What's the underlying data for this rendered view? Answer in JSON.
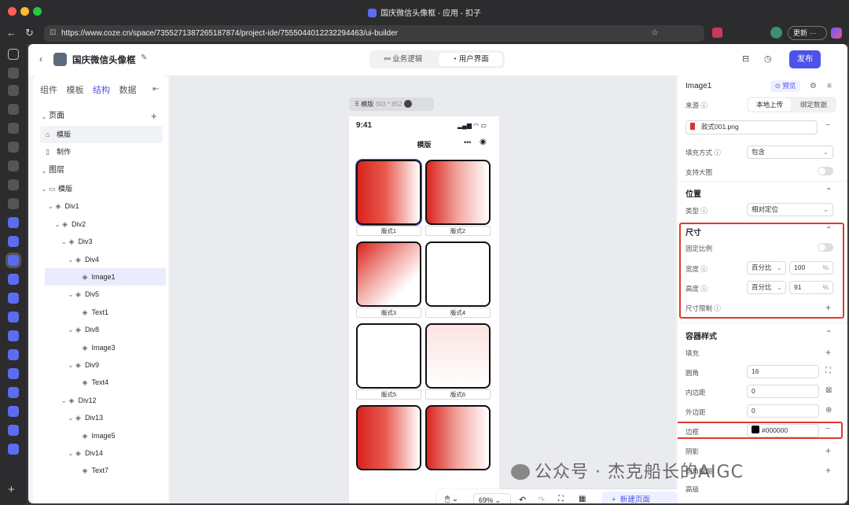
{
  "window": {
    "title": "国庆微信头像框 - 应用 - 扣子"
  },
  "browser": {
    "url": "https://www.coze.cn/space/7355271387265187874/project-ide/7555044012232294463/ui-builder",
    "update_label": "更新"
  },
  "topbar": {
    "project_name": "国庆微信头像框",
    "tab_logic": "业务逻辑",
    "tab_ui": "用户界面",
    "publish": "发布"
  },
  "left_panel": {
    "tabs": [
      "组件",
      "模板",
      "结构",
      "数据"
    ],
    "pages_title": "页面",
    "pages": [
      "模版",
      "制作"
    ],
    "layers_title": "图层",
    "layers": [
      {
        "label": "模版",
        "indent": 0
      },
      {
        "label": "Div1",
        "indent": 1
      },
      {
        "label": "Div2",
        "indent": 2
      },
      {
        "label": "Div3",
        "indent": 3
      },
      {
        "label": "Div4",
        "indent": 4
      },
      {
        "label": "Image1",
        "indent": 5
      },
      {
        "label": "Div5",
        "indent": 4
      },
      {
        "label": "Text1",
        "indent": 5
      },
      {
        "label": "Div8",
        "indent": 4
      },
      {
        "label": "Image3",
        "indent": 5
      },
      {
        "label": "Div9",
        "indent": 4
      },
      {
        "label": "Text4",
        "indent": 5
      },
      {
        "label": "Div12",
        "indent": 3
      },
      {
        "label": "Div13",
        "indent": 4
      },
      {
        "label": "Image5",
        "indent": 5
      },
      {
        "label": "Div14",
        "indent": 4
      },
      {
        "label": "Text7",
        "indent": 5
      }
    ]
  },
  "canvas": {
    "frame_label": "模版",
    "frame_size": "393 * 852",
    "status_time": "9:41",
    "page_title": "模版",
    "cards": [
      {
        "label": "版式1"
      },
      {
        "label": "版式2"
      },
      {
        "label": "版式3"
      },
      {
        "label": "版式4"
      },
      {
        "label": "版式5"
      },
      {
        "label": "版式6"
      },
      {
        "label": ""
      },
      {
        "label": ""
      }
    ],
    "zoom": "69%",
    "new_page": "新建页面"
  },
  "right_panel": {
    "component": "Image1",
    "preview": "预览",
    "source_label": "来源",
    "source_local": "本地上传",
    "source_bind": "绑定数据",
    "file_name": "款式001.png",
    "fill_label": "填充方式",
    "fill_value": "包含",
    "big_image_label": "支持大图",
    "position_title": "位置",
    "type_label": "类型",
    "type_value": "相对定位",
    "size_title": "尺寸",
    "lock_ratio": "固定比例",
    "width_label": "宽度",
    "width_unit": "百分比",
    "width_value": "100",
    "width_pct": "%",
    "height_label": "高度",
    "height_unit": "百分比",
    "height_value": "91",
    "height_pct": "%",
    "size_limit": "尺寸限制",
    "container_title": "容器样式",
    "fill": "填充",
    "radius_label": "圆角",
    "radius_value": "16",
    "padding_label": "内边距",
    "padding_value": "0",
    "margin_label": "外边距",
    "margin_value": "0",
    "border_label": "边框",
    "border_value": "#000000",
    "shadow_label": "阴影",
    "next_label": "圆角模糊",
    "last_label": "高级"
  },
  "watermark": "公众号 · 杰克船长的AIGC"
}
